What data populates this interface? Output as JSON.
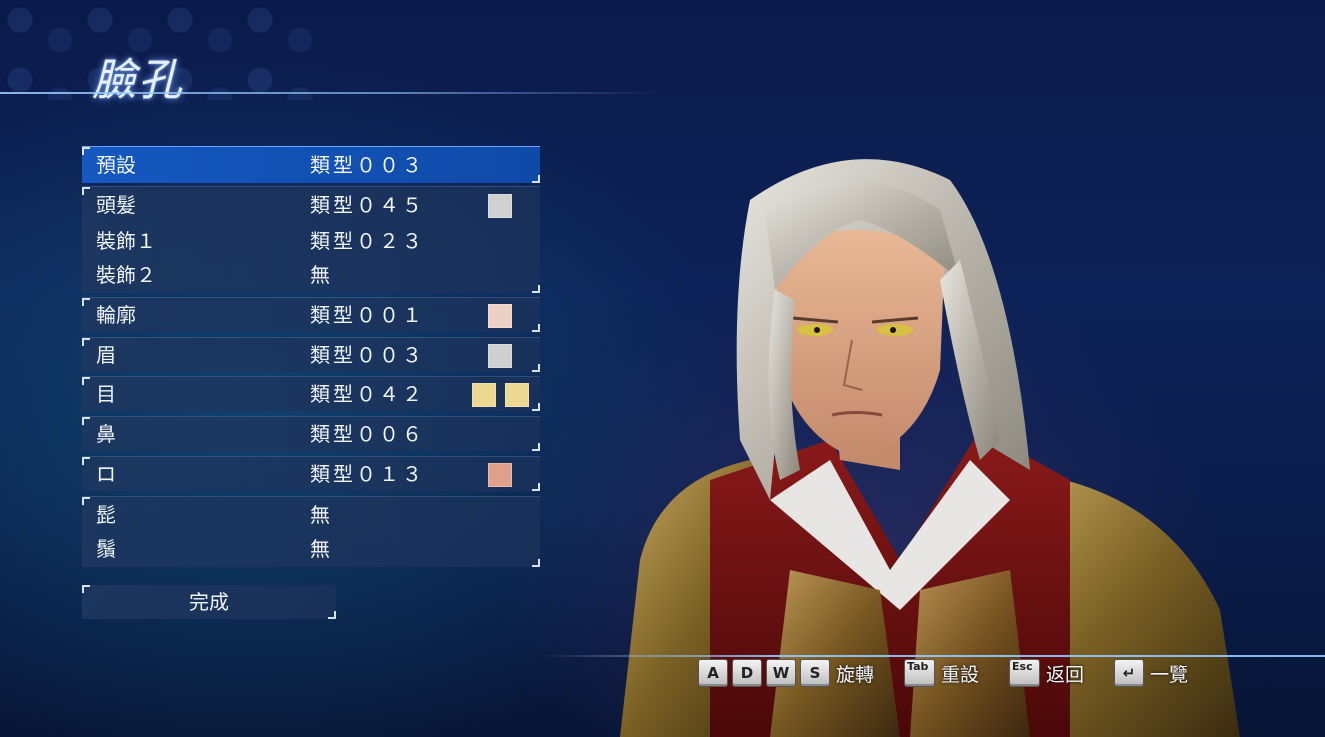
{
  "title": "臉孔",
  "menu": {
    "preset": {
      "label": "預設",
      "value": "類型００３"
    },
    "hair": {
      "label": "頭髮",
      "value": "類型０４５",
      "swatch": "#d0d0d0"
    },
    "accessory1": {
      "label": "裝飾１",
      "value": "類型０２３"
    },
    "accessory2": {
      "label": "裝飾２",
      "value": "無"
    },
    "contour": {
      "label": "輪廓",
      "value": "類型００１",
      "swatch": "#ecd0c4"
    },
    "brow": {
      "label": "眉",
      "value": "類型００３",
      "swatch": "#cfcfcf"
    },
    "eye": {
      "label": "目",
      "value": "類型０４２",
      "swatch1": "#ecd890",
      "swatch2": "#ecd890"
    },
    "nose": {
      "label": "鼻",
      "value": "類型００６"
    },
    "mouth": {
      "label": "ロ",
      "value": "類型０１３",
      "swatch": "#e0a08c"
    },
    "mustache": {
      "label": "髭",
      "value": "無"
    },
    "beard": {
      "label": "鬚",
      "value": "無"
    }
  },
  "done_label": "完成",
  "controls": {
    "rotate": {
      "keys": [
        "A",
        "D",
        "W",
        "S"
      ],
      "label": "旋轉"
    },
    "reset": {
      "key": "Tab",
      "label": "重設"
    },
    "back": {
      "key": "Esc",
      "label": "返回"
    },
    "list": {
      "key": "↵",
      "label": "一覽"
    }
  },
  "colors": {
    "selected_row": "#1558c0",
    "row_bg": "#1e375f",
    "accent_line": "#96c8ff"
  }
}
